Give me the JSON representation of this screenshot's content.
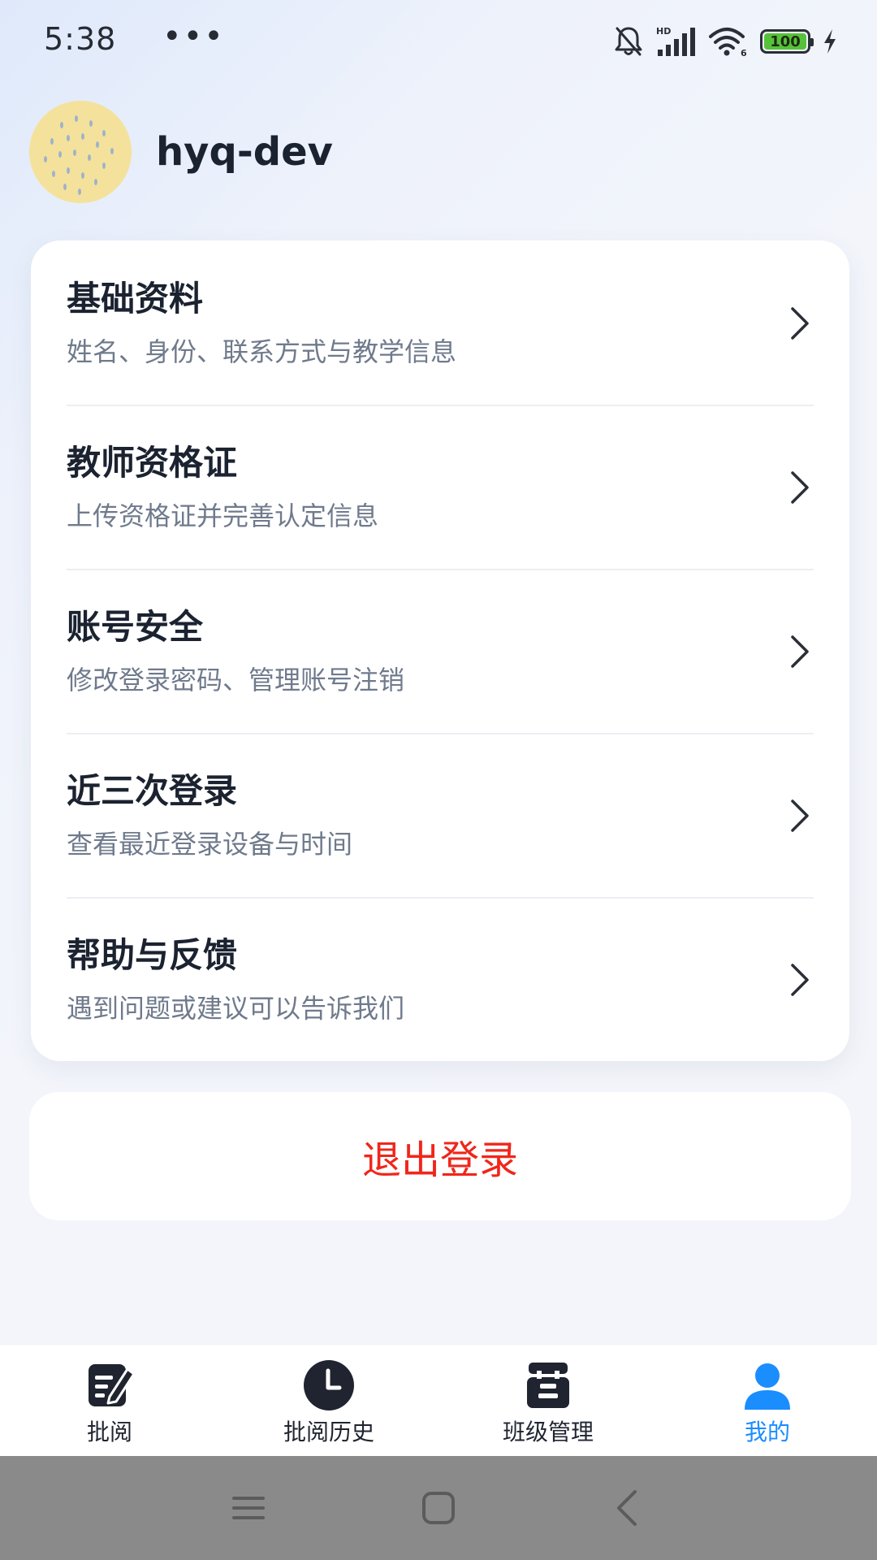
{
  "status_bar": {
    "time": "5:38",
    "dots": "•••",
    "battery": "100",
    "icons": [
      "bell-off-icon",
      "signal-icon",
      "wifi-icon",
      "battery-icon",
      "charging-icon"
    ]
  },
  "profile": {
    "username": "hyq-dev"
  },
  "menu": {
    "items": [
      {
        "title": "基础资料",
        "subtitle": "姓名、身份、联系方式与教学信息"
      },
      {
        "title": "教师资格证",
        "subtitle": "上传资格证并完善认定信息"
      },
      {
        "title": "账号安全",
        "subtitle": "修改登录密码、管理账号注销"
      },
      {
        "title": "近三次登录",
        "subtitle": "查看最近登录设备与时间"
      },
      {
        "title": "帮助与反馈",
        "subtitle": "遇到问题或建议可以告诉我们"
      }
    ]
  },
  "logout": {
    "label": "退出登录",
    "color": "#f0261b"
  },
  "tabs": [
    {
      "label": "批阅",
      "icon": "edit-document-icon"
    },
    {
      "label": "批阅历史",
      "icon": "clock-icon"
    },
    {
      "label": "班级管理",
      "icon": "class-icon"
    },
    {
      "label": "我的",
      "icon": "user-icon",
      "active": true
    }
  ],
  "colors": {
    "accent": "#1a8dff",
    "danger": "#f0261b"
  },
  "nav_bar": {
    "buttons": [
      "menu-icon",
      "home-icon",
      "back-icon"
    ]
  }
}
